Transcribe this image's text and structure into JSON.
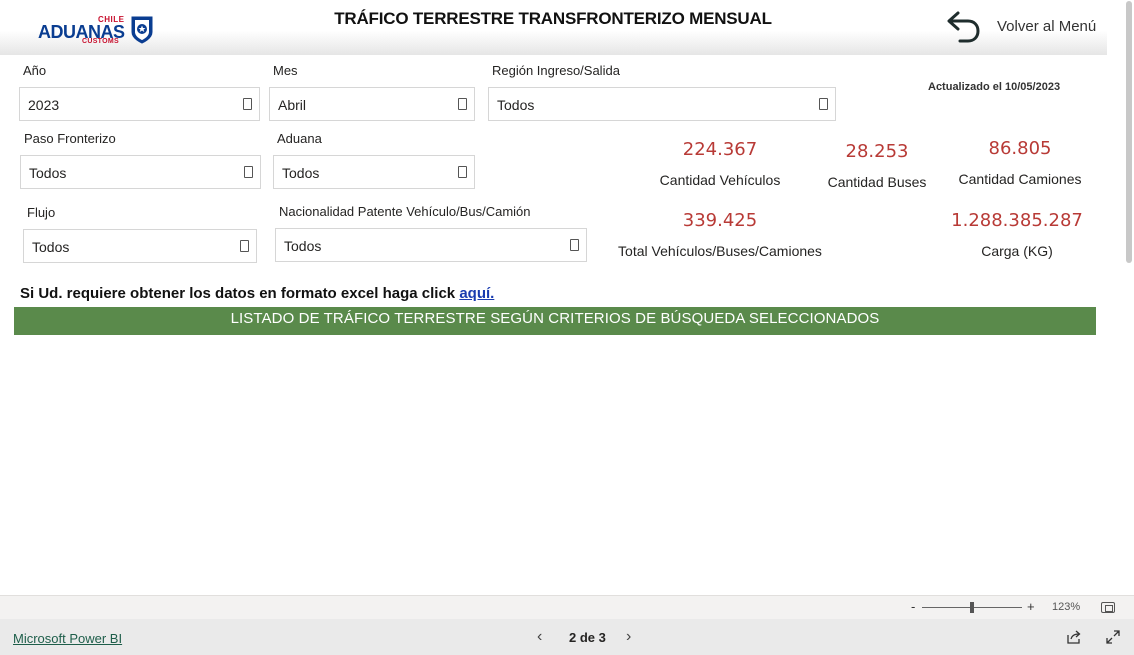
{
  "header": {
    "logo": {
      "top_text": "CHILE",
      "main_text": "ADUANAS",
      "sub_text": "CUSTOMS"
    },
    "title": "TRÁFICO TERRESTRE TRANSFRONTERIZO MENSUAL",
    "back_label": "Volver al Menú",
    "back_icon": "undo-arrow-icon"
  },
  "filters": {
    "year": {
      "label": "Año",
      "value": "2023"
    },
    "month": {
      "label": "Mes",
      "value": "Abril"
    },
    "region": {
      "label": "Región Ingreso/Salida",
      "value": "Todos"
    },
    "border_pass": {
      "label": "Paso Fronterizo",
      "value": "Todos"
    },
    "customs": {
      "label": "Aduana",
      "value": "Todos"
    },
    "flow": {
      "label": "Flujo",
      "value": "Todos"
    },
    "plate_nationality": {
      "label": "Nacionalidad Patente Vehículo/Bus/Camión",
      "value": "Todos"
    }
  },
  "updated": "Actualizado el 10/05/2023",
  "kpis": {
    "vehicles": {
      "value": "224.367",
      "label": "Cantidad Vehículos"
    },
    "buses": {
      "value": "28.253",
      "label": "Cantidad Buses"
    },
    "trucks": {
      "value": "86.805",
      "label": "Cantidad Camiones"
    },
    "total": {
      "value": "339.425",
      "label": "Total Vehículos/Buses/Camiones"
    },
    "cargo": {
      "value": "1.288.385.287",
      "label": "Carga (KG)"
    }
  },
  "excel": {
    "text": "Si Ud. requiere obtener los datos en formato excel haga click ",
    "link": "aquí."
  },
  "banner": "LISTADO DE TRÁFICO TERRESTRE SEGÚN CRITERIOS DE BÚSQUEDA SELECCIONADOS",
  "zoom": {
    "minus": "-",
    "plus": "+",
    "level": "123%",
    "slider_fraction": 0.5
  },
  "footer": {
    "powerbi_link": "Microsoft Power BI",
    "prev": "‹",
    "page": "2 de 3",
    "next": "›"
  },
  "colors": {
    "kpi_value": "#b83a36",
    "banner": "#5a8a4b",
    "logo_blue": "#0a3d91",
    "logo_red": "#c8102e"
  }
}
